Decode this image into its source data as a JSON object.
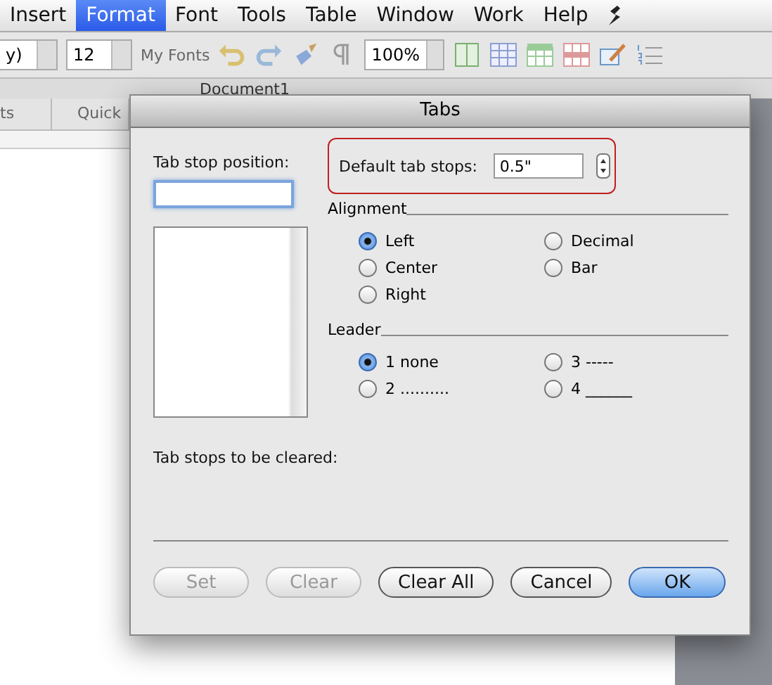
{
  "menu_bar": {
    "items": [
      {
        "label": "Insert",
        "selected": false
      },
      {
        "label": "Format",
        "selected": true
      },
      {
        "label": "Font",
        "selected": false
      },
      {
        "label": "Tools",
        "selected": false
      },
      {
        "label": "Table",
        "selected": false
      },
      {
        "label": "Window",
        "selected": false
      },
      {
        "label": "Work",
        "selected": false
      },
      {
        "label": "Help",
        "selected": false
      }
    ]
  },
  "toolbar": {
    "font_field": "y)",
    "size_field": "12",
    "fonts_menu": "My Fonts",
    "zoom_field": "100%"
  },
  "document": {
    "title": "Document1",
    "tabs": [
      "ts",
      "Quick"
    ]
  },
  "dialog": {
    "title": "Tabs",
    "tab_stop_position": {
      "label": "Tab stop position:"
    },
    "default_tab_stops": {
      "label": "Default tab stops:",
      "value": "0.5\""
    },
    "alignment": {
      "title": "Alignment",
      "options": [
        {
          "label": "Left",
          "selected": true
        },
        {
          "label": "Decimal",
          "selected": false
        },
        {
          "label": "Center",
          "selected": false
        },
        {
          "label": "Bar",
          "selected": false
        },
        {
          "label": "Right",
          "selected": false
        }
      ]
    },
    "leader": {
      "title": "Leader",
      "options": [
        {
          "label": "1 none",
          "selected": true
        },
        {
          "label": "3 -----",
          "selected": false
        },
        {
          "label": "2 ..........",
          "selected": false
        },
        {
          "label": "4 ______",
          "selected": false
        }
      ]
    },
    "cleared_label": "Tab stops to be cleared:",
    "buttons": [
      {
        "label": "Set",
        "disabled": true,
        "default": false
      },
      {
        "label": "Clear",
        "disabled": true,
        "default": false
      },
      {
        "label": "Clear All",
        "disabled": false,
        "default": false
      },
      {
        "label": "Cancel",
        "disabled": false,
        "default": false
      },
      {
        "label": "OK",
        "disabled": false,
        "default": true
      }
    ]
  }
}
